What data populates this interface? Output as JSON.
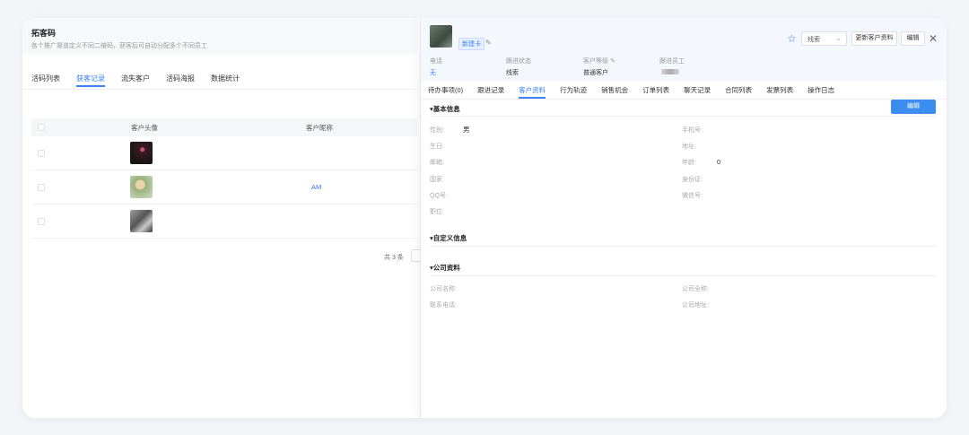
{
  "left": {
    "title": "拓客码",
    "desc": "各个推广渠道定义不同二维码，获客后可自动分配多个不同员工",
    "tabs": [
      "活码列表",
      "获客记录",
      "流失客户",
      "活码海报",
      "数据统计"
    ],
    "active_tab": 1,
    "table": {
      "headers": [
        "客户头像",
        "客户昵称"
      ],
      "rows": [
        {
          "nickname": ""
        },
        {
          "nickname": "AM"
        },
        {
          "nickname": ""
        }
      ]
    },
    "total": "共 3 条"
  },
  "right": {
    "tag": "新建卡",
    "status_select": "线索",
    "buttons": {
      "update": "更新客户资料",
      "edit": "编辑"
    },
    "fields": [
      {
        "label": "电话",
        "value": "无"
      },
      {
        "label": "跟进状态",
        "value": "线索"
      },
      {
        "label": "客户等级",
        "value": "普通客户"
      },
      {
        "label": "跟进员工",
        "value": ""
      }
    ],
    "tabs": [
      "待办事项(0)",
      "跟进记录",
      "客户资料",
      "行为轨迹",
      "销售机会",
      "订单列表",
      "聊天记录",
      "合同列表",
      "发票列表",
      "操作日志"
    ],
    "active_tab": 2,
    "sections": {
      "basic": "基本信息",
      "custom": "自定义信息",
      "company": "公司资料"
    },
    "edit_button": "编辑",
    "basic_left": [
      {
        "label": "性别:",
        "value": "男"
      },
      {
        "label": "生日:",
        "value": ""
      },
      {
        "label": "邮箱:",
        "value": ""
      },
      {
        "label": "国家:",
        "value": ""
      },
      {
        "label": "QQ号:",
        "value": ""
      },
      {
        "label": "职位:",
        "value": ""
      }
    ],
    "basic_right": [
      {
        "label": "手机号:",
        "value": ""
      },
      {
        "label": "地址:",
        "value": ""
      },
      {
        "label": "年龄:",
        "value": "0"
      },
      {
        "label": "身份证:",
        "value": ""
      },
      {
        "label": "微信号:",
        "value": ""
      }
    ],
    "company_left": [
      {
        "label": "公司名称:",
        "value": ""
      },
      {
        "label": "联系电话:",
        "value": ""
      }
    ],
    "company_right": [
      {
        "label": "公司全称:",
        "value": ""
      },
      {
        "label": "公司地址:",
        "value": ""
      }
    ]
  },
  "colors": {
    "accent": "#3b82f6",
    "button": "#3b8ef0"
  },
  "icons": {
    "star": "star-icon",
    "close": "close-icon",
    "pen": "pen-icon",
    "chevron": "chevron-down-icon"
  }
}
